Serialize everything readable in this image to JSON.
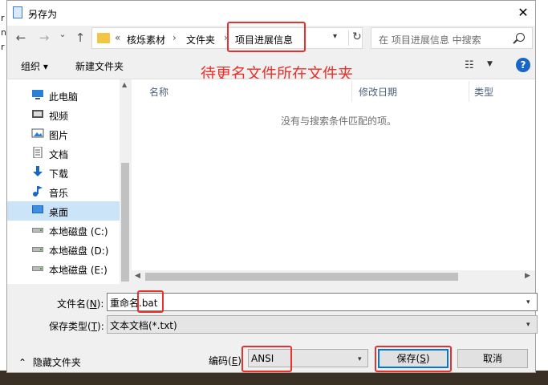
{
  "background": {
    "fragments": [
      "r",
      "n",
      "r"
    ]
  },
  "dialog": {
    "title": "另存为",
    "close_glyph": "✕"
  },
  "nav": {
    "back_glyph": "←",
    "forward_glyph": "→",
    "recent_glyph": "⌄",
    "up_glyph": "↑",
    "breadcrumb_overflow": "«",
    "breadcrumb": [
      "核烁素材",
      "文件夹",
      "项目进展信息"
    ],
    "separator": "›",
    "refresh_glyph": "↻",
    "search_placeholder": "在 项目进展信息 中搜索"
  },
  "toolbar": {
    "organize_label": "组织 ▾",
    "new_folder_label": "新建文件夹",
    "view_glyph": "☷",
    "help_glyph": "?"
  },
  "annotation": {
    "text": "待更名文件所在文件夹"
  },
  "sidebar": {
    "items": [
      {
        "label": "此电脑",
        "icon": "computer-icon",
        "color": "#2b7fd4"
      },
      {
        "label": "视频",
        "icon": "video-icon",
        "color": "#555555"
      },
      {
        "label": "图片",
        "icon": "picture-icon",
        "color": "#555555"
      },
      {
        "label": "文档",
        "icon": "document-icon",
        "color": "#555555"
      },
      {
        "label": "下载",
        "icon": "download-icon",
        "color": "#1a66c6"
      },
      {
        "label": "音乐",
        "icon": "music-icon",
        "color": "#1a66c6"
      },
      {
        "label": "桌面",
        "icon": "desktop-icon",
        "color": "#1a66c6",
        "selected": true
      },
      {
        "label": "本地磁盘 (C:)",
        "icon": "drive-icon",
        "color": "#777777"
      },
      {
        "label": "本地磁盘 (D:)",
        "icon": "drive-icon",
        "color": "#777777"
      },
      {
        "label": "本地磁盘 (E:)",
        "icon": "drive-icon",
        "color": "#777777"
      }
    ]
  },
  "filelist": {
    "columns": [
      "名称",
      "修改日期",
      "类型"
    ],
    "empty_message": "没有与搜索条件匹配的项。"
  },
  "form": {
    "filename_label_pre": "文件名(",
    "filename_label_key": "N",
    "filename_label_post": "):",
    "filename_value": "重命名.bat",
    "savetype_label_pre": "保存类型(",
    "savetype_label_key": "T",
    "savetype_label_post": "):",
    "savetype_value": "文本文档(*.txt)",
    "encoding_label_pre": "编码(",
    "encoding_label_key": "E",
    "encoding_label_post": ")",
    "encoding_value": "ANSI"
  },
  "footer": {
    "hide_folders_label": "隐藏文件夹",
    "hide_glyph": "⌃",
    "save_label_pre": "保存(",
    "save_label_key": "S",
    "save_label_post": ")",
    "cancel_label": "取消"
  },
  "colors": {
    "annotation": "#e8312b",
    "accent": "#0078d7",
    "selection": "#cce4f7"
  }
}
